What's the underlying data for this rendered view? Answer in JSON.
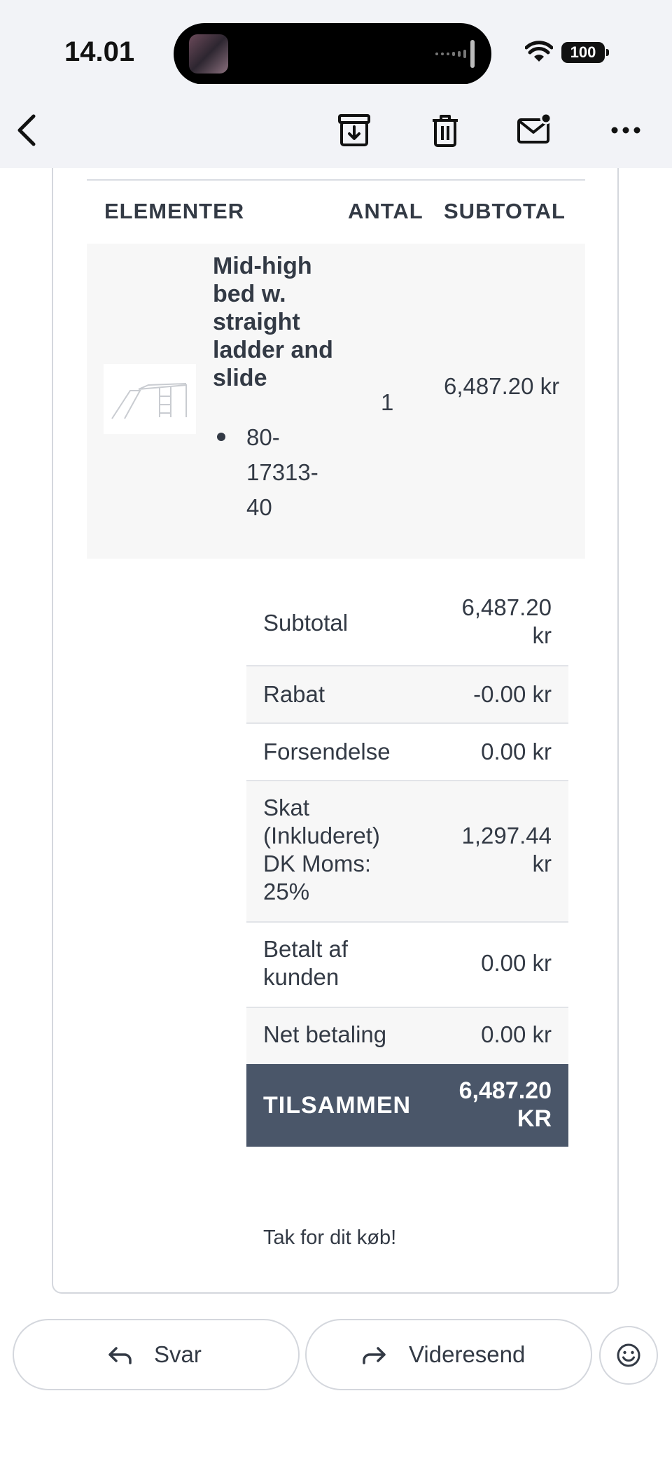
{
  "status_bar": {
    "time": "14.01",
    "battery": "100"
  },
  "table": {
    "headers": {
      "items": "ELEMENTER",
      "qty": "ANTAL",
      "subtotal": "SUBTOTAL"
    },
    "item": {
      "name": "Mid-high bed w. straight ladder and slide",
      "sku": "80-17313-40",
      "qty": "1",
      "subtotal": "6,487.20 kr"
    }
  },
  "totals": [
    {
      "label": "Subtotal",
      "value": "6,487.20 kr"
    },
    {
      "label": "Rabat",
      "value": "-0.00 kr"
    },
    {
      "label": "Forsendelse",
      "value": "0.00 kr"
    },
    {
      "label": "Skat (Inkluderet) DK Moms: 25%",
      "value": "1,297.44 kr"
    },
    {
      "label": "Betalt af kunden",
      "value": "0.00 kr"
    },
    {
      "label": "Net betaling",
      "value": "0.00 kr"
    }
  ],
  "grand_total": {
    "label": "TILSAMMEN",
    "value": "6,487.20 KR"
  },
  "thanks": "Tak for dit køb!",
  "actions": {
    "reply": "Svar",
    "forward": "Videresend"
  },
  "icons": {
    "back": "chevron-left-icon",
    "archive": "archive-icon",
    "delete": "trash-icon",
    "unread": "mail-unread-icon",
    "more": "more-horizontal-icon",
    "reply": "reply-arrow-icon",
    "forward": "forward-arrow-icon",
    "emoji": "emoji-smile-icon"
  }
}
